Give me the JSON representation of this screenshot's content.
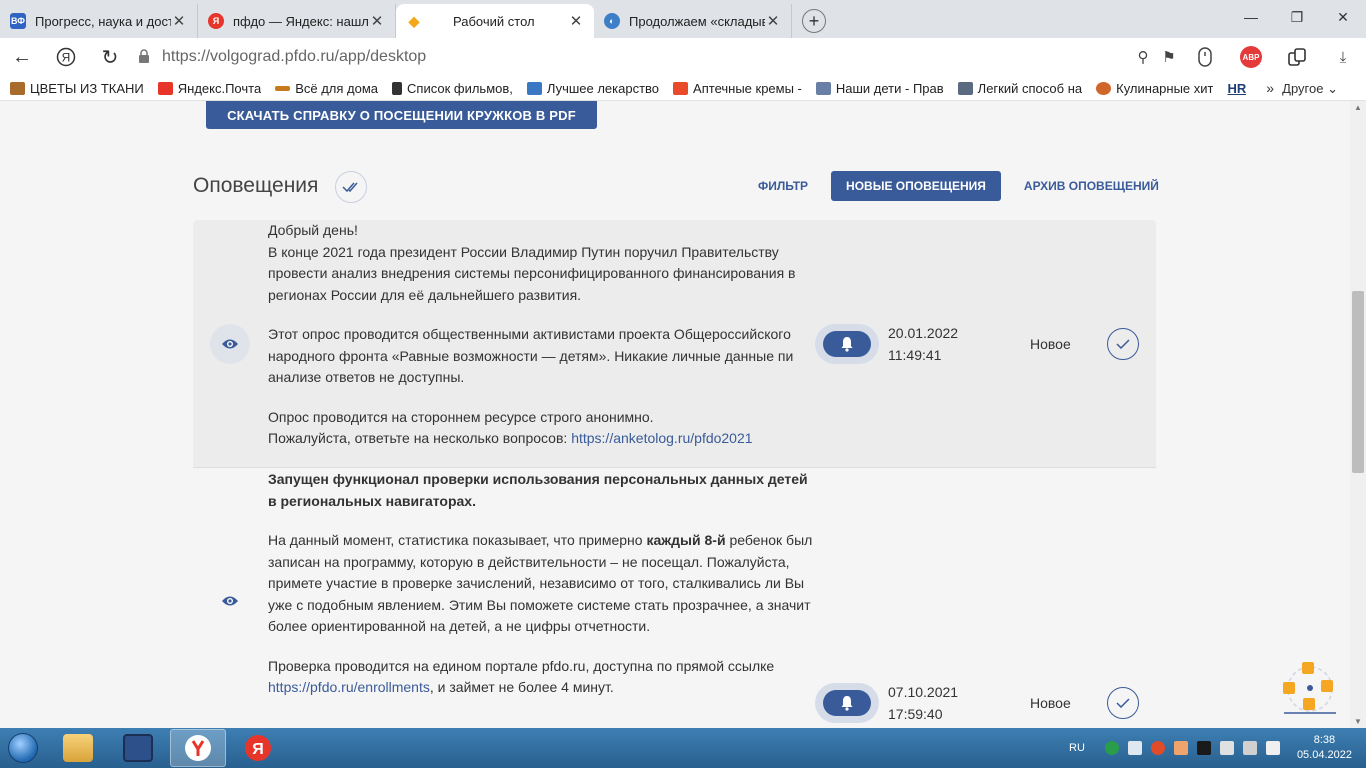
{
  "browser": {
    "tabs": [
      {
        "title": "Прогресс, наука и достиж",
        "favicon": "ВФ",
        "color": "#2f64c2",
        "active": false
      },
      {
        "title": "пфдо — Яндекс: нашлось",
        "favicon": "Я",
        "color": "#e8352a",
        "active": false
      },
      {
        "title": "Рабочий стол",
        "favicon": "◆",
        "color": "#f3a81c",
        "active": true
      },
      {
        "title": "Продолжаем «складыватв",
        "favicon": "◐",
        "color": "#3d7ec9",
        "active": false
      }
    ],
    "new_tab": "+",
    "url": "https://volgograd.pfdo.ru/app/desktop",
    "abp_label": "ABP",
    "bookmarks": [
      {
        "label": "ЦВЕТЫ ИЗ ТКАНИ",
        "color": "#a86b2c"
      },
      {
        "label": "Яндекс.Почта",
        "color": "#e8352a"
      },
      {
        "label": "Всё для дома",
        "color": "#c77a1b"
      },
      {
        "label": "Список фильмов,",
        "color": "#333333"
      },
      {
        "label": "Лучшее лекарство",
        "color": "#3a78c4"
      },
      {
        "label": "Аптечные кремы -",
        "color": "#e84a2a"
      },
      {
        "label": "Наши дети - Прав",
        "color": "#6a7fa6"
      },
      {
        "label": "Легкий способ на",
        "color": "#5a6a80"
      },
      {
        "label": "Кулинарные хит",
        "color": "#d0662a"
      },
      {
        "label": "HR",
        "color": "#1e3f7a"
      }
    ],
    "bookmarks_more": "»",
    "bookmarks_other": "Другое"
  },
  "page": {
    "pdf_button": "СКАЧАТЬ СПРАВКУ О ПОСЕЩЕНИИ КРУЖКОВ В PDF",
    "section_title": "Оповещения",
    "tabs": {
      "filter": "ФИЛЬТР",
      "new": "НОВЫЕ ОПОВЕЩЕНИЯ",
      "archive": "АРХИВ ОПОВЕЩЕНИЙ"
    },
    "notifications": [
      {
        "p1": "Добрый день!",
        "p2": "В конце 2021 года президент России Владимир Путин поручил Правительству провести анализ внедрения системы персонифицированного финансирования в регионах России для её дальнейшего развития.",
        "p3": "Этот опрос проводится общественными активистами проекта Общероссийского народного фронта «Равные возможности — детям». Никакие личные данные пи анализе ответов не доступны.",
        "p4": "Опрос проводится на стороннем ресурсе строго анонимно.",
        "p5": "Пожалуйста, ответьте на несколько вопросов: ",
        "link": "https://anketolog.ru/pfdo2021",
        "date": "20.01.2022",
        "time": "11:49:41",
        "status": "Новое"
      },
      {
        "title": "Запущен функционал проверки использования персональных данных детей в региональных навигаторах.",
        "p1_a": "На данный момент, статистика показывает, что примерно ",
        "p1_b": "каждый 8-й",
        "p1_c": " ребенок был записан на программу, которую в действительности – не посещал. Пожалуйста, примете участие в проверке зачислений, независимо от того, сталкивались ли Вы уже с подобным явлением. Этим Вы поможете системе стать прозрачнее, а значит более ориентированной на детей, а не цифры отчетности.",
        "p2_a": "Проверка проводится на едином портале pfdo.ru, доступна по прямой ссылке ",
        "link": "https://pfdo.ru/enrollments",
        "p2_b": ", и займет не более 4 минут.",
        "date": "07.10.2021",
        "time": "17:59:40",
        "status": "Новое"
      }
    ]
  },
  "taskbar": {
    "lang": "RU",
    "time": "8:38",
    "date": "05.04.2022"
  }
}
